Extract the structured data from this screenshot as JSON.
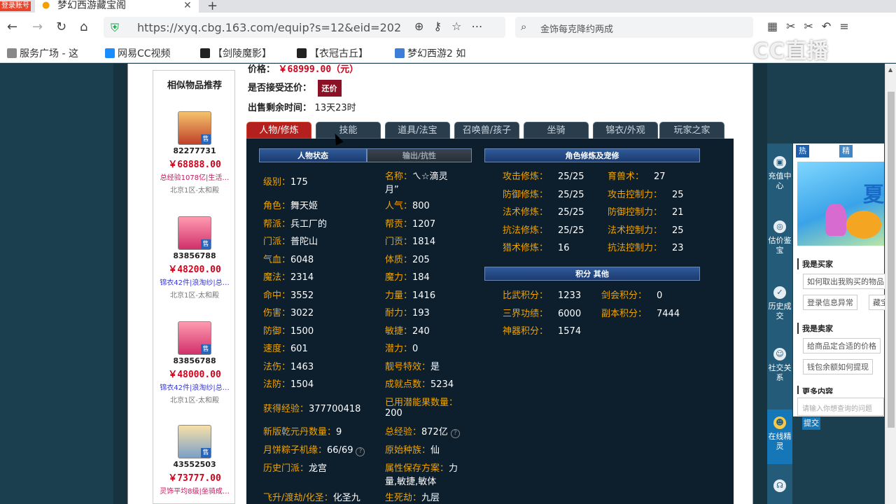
{
  "browser": {
    "badge": "登录账号",
    "tab_title": "梦幻西游藏宝阁",
    "tab_close": "✕",
    "tab_new": "+",
    "url": "https://xyq.cbg.163.com/equip?s=12&eid=202",
    "search_placeholder": "金饰每克降约两成",
    "bookmarks": [
      "服务广场 - 这",
      "网易CC视频",
      "【剑陵魔影】",
      "【衣冠古丘】",
      "梦幻西游2 如"
    ],
    "watermark": "CC直播"
  },
  "item": {
    "price_label": "价格：",
    "price_value": "￥68999.00（元）",
    "bargain_label": "是否接受还价：",
    "bargain_button": "还价",
    "remaining_label": "出售剩余时间：",
    "remaining_value": "13天23时"
  },
  "similar": {
    "title": "相似物品推荐",
    "items": [
      {
        "id": "82277731",
        "price": "￥68888.00",
        "desc": "总经验1078亿|生活…",
        "desc_color": "#c2185b",
        "server": "北京1区-太和殿",
        "sell": "售"
      },
      {
        "id": "83856788",
        "price": "￥48200.00",
        "desc": "锦衣42件|浪淘纱|总…",
        "desc_color": "#3a3ad8",
        "server": "北京1区-太和殿",
        "sell": "售"
      },
      {
        "id": "83856788",
        "price": "￥48000.00",
        "desc": "锦衣42件|浪淘纱|总…",
        "desc_color": "#3a3ad8",
        "server": "北京1区-太和殿",
        "sell": "售"
      },
      {
        "id": "43552503",
        "price": "￥73777.00",
        "desc": "灵饰平均8级|坐骑成…",
        "desc_color": "#c2185b",
        "server": "",
        "sell": "售"
      }
    ]
  },
  "tabs": [
    "人物/修炼",
    "技能",
    "道具/法宝",
    "召唤兽/孩子",
    "坐骑",
    "锦衣/外观",
    "玩家之家"
  ],
  "sections": {
    "status": "人物状态",
    "resist": "输出/抗性",
    "cultivation": "角色修炼及宠修",
    "points": "积分 其他"
  },
  "stats_left": [
    {
      "k": "级别：",
      "v": "175"
    },
    {
      "k": "角色：",
      "v": "舞天姬"
    },
    {
      "k": "帮派：",
      "v": "兵工厂的"
    },
    {
      "k": "门派：",
      "v": "普陀山"
    },
    {
      "k": "气血：",
      "v": "6048"
    },
    {
      "k": "魔法：",
      "v": "2314"
    },
    {
      "k": "命中：",
      "v": "3552"
    },
    {
      "k": "伤害：",
      "v": "3022"
    },
    {
      "k": "防御：",
      "v": "1500"
    },
    {
      "k": "速度：",
      "v": "601"
    },
    {
      "k": "法伤：",
      "v": "1463"
    },
    {
      "k": "法防：",
      "v": "1504"
    },
    {
      "k": "获得经验：",
      "v": "377700418"
    },
    {
      "k": "新版乾元丹数量：",
      "v": "9"
    },
    {
      "k": "月饼粽子机缘：",
      "v": "66/69"
    },
    {
      "k": "历史门派：",
      "v": "龙宫"
    },
    {
      "k": "飞升/渡劫/化圣：",
      "v": "化圣九"
    }
  ],
  "stats_mid": [
    {
      "k": "名称：",
      "v": "ㄟ☆滴灵",
      "v2": "月”"
    },
    {
      "k": "人气：",
      "v": "800"
    },
    {
      "k": "帮贡：",
      "v": "1207"
    },
    {
      "k": "门贡：",
      "v": "1814"
    },
    {
      "k": "体质：",
      "v": "205"
    },
    {
      "k": "魔力：",
      "v": "184"
    },
    {
      "k": "力量：",
      "v": "1416"
    },
    {
      "k": "耐力：",
      "v": "193"
    },
    {
      "k": "敏捷：",
      "v": "240"
    },
    {
      "k": "潜力：",
      "v": "0"
    },
    {
      "k": "靓号特效：",
      "v": "是"
    },
    {
      "k": "成就点数：",
      "v": "5234"
    },
    {
      "k": "已用潜能果数量：",
      "v": "200"
    },
    {
      "k": "总经验：",
      "v": "872亿"
    },
    {
      "k": "原始种族：",
      "v": "仙"
    },
    {
      "k": "属性保存方案：",
      "v": "力",
      "v2": "量,敏捷,敏体"
    },
    {
      "k": "生死劫：",
      "v": "九层"
    }
  ],
  "cultivation": [
    {
      "k": "攻击修炼：",
      "v": "25/25",
      "k2": "育兽术：",
      "v2": "27"
    },
    {
      "k": "防御修炼：",
      "v": "25/25",
      "k2": "攻击控制力：",
      "v2": "25"
    },
    {
      "k": "法术修炼：",
      "v": "25/25",
      "k2": "防御控制力：",
      "v2": "21"
    },
    {
      "k": "抗法修炼：",
      "v": "25/25",
      "k2": "法术控制力：",
      "v2": "25"
    },
    {
      "k": "猎术修炼：",
      "v": "16",
      "k2": "抗法控制力：",
      "v2": "23"
    }
  ],
  "points": [
    {
      "k": "比武积分：",
      "v": "1233",
      "k2": "剑会积分：",
      "v2": "0"
    },
    {
      "k": "三界功绩：",
      "v": "6000",
      "k2": "副本积分：",
      "v2": "7444"
    },
    {
      "k": "神器积分：",
      "v": "1574",
      "k2": "",
      "v2": ""
    }
  ],
  "sidebar": {
    "tools": [
      "充值中心",
      "估价鉴宝",
      "历史成交",
      "社交关系",
      "在线精灵"
    ],
    "tabs": [
      "热门问题",
      "精灵问答"
    ],
    "banner_text": "夏",
    "buyer_title": "我是买家",
    "buyer_q": [
      "如何取出我购买的物品",
      "登录信息异常",
      "藏宝"
    ],
    "seller_title": "我是卖家",
    "seller_q": [
      "给商品定合适的价格",
      "钱包余额如何提现"
    ],
    "more_title": "更多内容",
    "input_placeholder": "请输入你想查询的问题",
    "submit": "提交"
  }
}
